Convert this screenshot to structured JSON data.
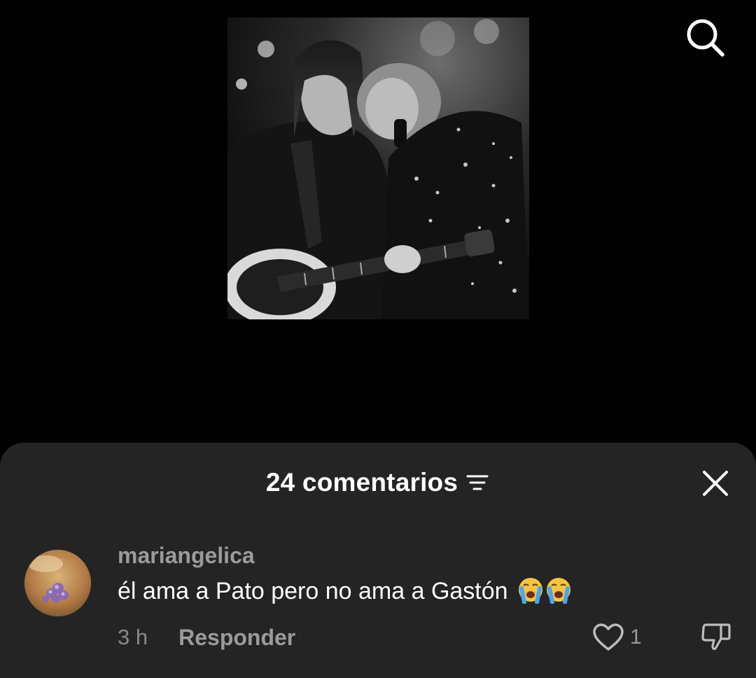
{
  "media": {
    "description_icon": "concert-photo"
  },
  "top_bar": {
    "search_icon": "search-icon"
  },
  "comments_sheet": {
    "title": "24 comentarios",
    "sort_icon": "filter-sort-icon",
    "close_icon": "close-icon"
  },
  "comment": {
    "username": "mariangelica",
    "text": "él ama a Pato pero no ama a Gastón",
    "emojis": "😭😭",
    "timestamp": "3 h",
    "reply_label": "Responder",
    "like_count": "1",
    "like_icon": "heart-outline-icon",
    "dislike_icon": "thumbs-down-icon"
  },
  "colors": {
    "background": "#000000",
    "sheet": "#242424",
    "text_primary": "#ffffff",
    "text_secondary": "#9b9b9b"
  }
}
